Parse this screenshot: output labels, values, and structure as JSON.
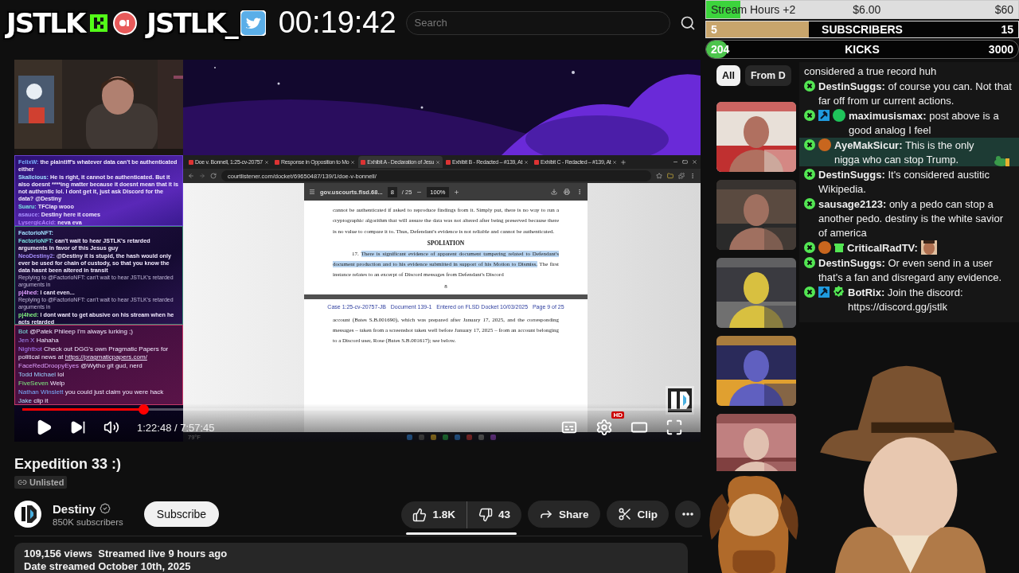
{
  "overlay_top": {
    "logos": [
      {
        "kind": "kick",
        "label": "JSTLK"
      },
      {
        "kind": "twitter",
        "label": "JSTLK_"
      }
    ],
    "timer": "00:19:42",
    "search": {
      "placeholder": "Search"
    }
  },
  "player": {
    "chats": [
      {
        "kind": "purple",
        "messages": [
          {
            "user": "FelixW:",
            "text": "the plaintiff's whatever data can't be authenticated either"
          },
          {
            "user": "Skalicious:",
            "text": "He is right, it cannot be authenticated. But it also doesnt ****ing matter because it doesnt mean that it is not authentic lol. I dont get it, just ask Discord for the data? @Destiny"
          },
          {
            "user": "Suaru:",
            "text": "TFClap wooo"
          },
          {
            "user": "asauce:",
            "text": "Destiny here it comes"
          },
          {
            "user": "LysergicAcid:",
            "text": "neva eva"
          }
        ]
      },
      {
        "kind": "dark",
        "messages": [
          {
            "user": "FactorioNFT:"
          },
          {
            "user": "FactorioNFT:",
            "text": "can't wait to hear JSTLK's retarded arguments in favor of this Jesus guy"
          },
          {
            "user": "NeoDestiny2:",
            "text": "@Destiny it is stupid, the hash would only ever be used for chain of custody, so that you know the data hasnt been altered in transit"
          },
          {
            "reply": "Replying to @FactorioNFT: can't wait to hear JSTLK's retarded arguments in"
          },
          {
            "user": "pj4hed:",
            "text": "I cant even..."
          },
          {
            "reply": "Replying to @FactorioNFT: can't wait to hear JSTLK's retarded arguments in"
          },
          {
            "user": "pj4hed:",
            "text": "I dont want to get abusive on his stream when he acts retarded"
          }
        ]
      },
      {
        "kind": "pink",
        "messages": [
          {
            "user": "Bot",
            "text": "@Patek Phileep I'm always lurking ;)"
          },
          {
            "user": "Jen X",
            "text": "Hahaha"
          },
          {
            "user": "Nightbot",
            "text": "Check out DGG's own Pragmatic Papers for political news at",
            "link": "https://pragmaticpapers.com/"
          },
          {
            "user": "FaceRedDroopyEyes",
            "text": "@Wytho git gud, nerd"
          },
          {
            "user": "Todd Michael",
            "text": "lol"
          },
          {
            "user": "FiveSeven",
            "text": "Welp"
          },
          {
            "user": "Nathan Winslett",
            "text": "you could just claim you were hack"
          },
          {
            "user": "Jake",
            "text": "clip it"
          }
        ]
      }
    ],
    "browser": {
      "tabs": [
        {
          "label": "Doe v. Bonnell, 1:25-cv-20757",
          "selected": false
        },
        {
          "label": "Response in Opposition to Mo",
          "selected": false
        },
        {
          "label": "Exhibit A - Declaration of Jesu",
          "selected": true
        },
        {
          "label": "Exhibit B - Redacted – #139, At",
          "selected": false
        },
        {
          "label": "Exhibit C - Redacted – #139, At",
          "selected": false
        }
      ],
      "url": "courtlistener.com/docket/69650487/139/1/doe-v-bonnell/",
      "pdf": {
        "file": "gov.uscourts.flsd.68...",
        "page": "8",
        "pages": "/ 25",
        "zoom": "100%",
        "blocks": [
          {
            "kind": "text",
            "text": "cannot be authenticated if asked to reproduce findings from it. Simply put, there is no way to run a cryptographic algorithm that will assure the data was not altered after being preserved because there is no value to compare it to. Thus, Defendant's evidence is not reliable and cannot be authenticated."
          },
          {
            "kind": "heading",
            "text": "SPOLIATION"
          },
          {
            "kind": "numbered",
            "number": "17.",
            "highlight": "There is significant evidence of apparent document tampering related to Defendant's document production and to his evidence submitted in support of his Motion to Dismiss.",
            "text": " The first instance relates to an excerpt of Discord messages from Defendant's Discord"
          },
          {
            "kind": "page_number",
            "text": "8"
          },
          {
            "kind": "header",
            "text": "Case 1:25-cv-20757-JB   Document 139-1   Entered on FLSD Docket 10/03/2025   Page 9 of 25"
          },
          {
            "kind": "text",
            "text": "account (Bates S.B.001690), which was prepared after January 17, 2025, and the corresponding messages – taken from a screenshot taken well before January 17, 2025 – from an account belonging to a Discord user, Rose (Bates S.B.001617); see below."
          }
        ]
      },
      "weather": "79°F"
    },
    "progress": {
      "level": 0.18
    },
    "time": "1:22:48 / 7:57:45",
    "quality_badge": "HD"
  },
  "video": {
    "title": "Expedition 33 :)",
    "visibility": "Unlisted",
    "channel": {
      "name": "Destiny",
      "verified": true,
      "subscribers": "850K subscribers"
    },
    "subscribe": "Subscribe",
    "likes": "1.8K",
    "dislikes": "43",
    "share": "Share",
    "clip": "Clip",
    "description": {
      "stats": "109,156 views  Streamed live 9 hours ago",
      "date": "Date streamed October 10th, 2025"
    }
  },
  "goals": [
    {
      "kind": "hours",
      "label": "Stream Hours +2",
      "current": "$6.00",
      "target": "$60",
      "level": 0.11
    },
    {
      "kind": "subs",
      "current": "5",
      "label": "SUBSCRIBERS",
      "target": "15",
      "level": 0.33
    },
    {
      "kind": "kicks",
      "current": "204",
      "label": "KICKS",
      "target": "3000",
      "level": 0.07
    }
  ],
  "sidebar": {
    "chips": [
      {
        "label": "All",
        "selected": true
      },
      {
        "label": "From D",
        "selected": false
      }
    ]
  },
  "chat": {
    "messages": [
      {
        "kind": "text",
        "text": "considered a true record huh",
        "highlighted": false
      },
      {
        "kind": "text",
        "user": "DestinSuggs:",
        "text": "of course you can. Not that far off from ur current actions.",
        "badges": [
          {
            "kind": "sub"
          }
        ],
        "highlighted": false
      },
      {
        "kind": "text",
        "user": "maximusismax:",
        "text": "post above is a good analog I feel",
        "badges": [
          {
            "kind": "sub"
          },
          {
            "kind": "mod"
          },
          {
            "kind": "orb",
            "color": "#1fc45a"
          }
        ],
        "highlighted": false
      },
      {
        "kind": "frog",
        "user": "AyeMakSicur:",
        "text": "This is the only nigga who can stop Trump.",
        "badges": [
          {
            "kind": "sub"
          },
          {
            "kind": "orb",
            "color": "#c8661e"
          }
        ],
        "highlighted": true
      },
      {
        "kind": "text",
        "user": "DestinSuggs:",
        "text": "It's considered austitic Wikipedia.",
        "badges": [
          {
            "kind": "sub"
          }
        ],
        "highlighted": false
      },
      {
        "kind": "text",
        "user": "sausage2123:",
        "text": "only a pedo can stop a another pedo. destiny is the white savior of america",
        "badges": [
          {
            "kind": "sub"
          }
        ],
        "highlighted": false
      },
      {
        "kind": "face",
        "user": "CriticalRadTV:",
        "badges": [
          {
            "kind": "sub"
          },
          {
            "kind": "orb",
            "color": "#c8661e"
          },
          {
            "kind": "gift"
          }
        ],
        "highlighted": false
      },
      {
        "kind": "text",
        "user": "DestinSuggs:",
        "text": "Or even send in a user that's a fan and disregard any evidence.",
        "badges": [
          {
            "kind": "sub"
          }
        ],
        "highlighted": false
      },
      {
        "kind": "text",
        "user": "BotRix:",
        "text": "Join the discord: https://discord.gg/jstlk",
        "badges": [
          {
            "kind": "sub"
          },
          {
            "kind": "mod"
          },
          {
            "kind": "verified"
          }
        ],
        "highlighted": false
      }
    ]
  }
}
